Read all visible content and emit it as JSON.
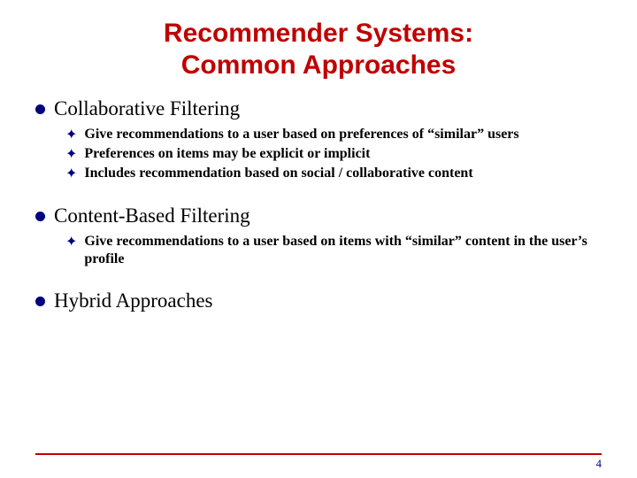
{
  "title_line1": "Recommender Systems:",
  "title_line2": "Common Approaches",
  "sections": [
    {
      "heading": "Collaborative Filtering",
      "items": [
        "Give recommendations to a user based on preferences of “similar” users",
        "Preferences on items may be explicit or implicit",
        "Includes recommendation based on social / collaborative content"
      ]
    },
    {
      "heading": "Content-Based Filtering",
      "items": [
        "Give recommendations to a user based on items with “similar” content in the user’s profile"
      ]
    },
    {
      "heading": "Hybrid Approaches",
      "items": []
    }
  ],
  "page_number": "4"
}
